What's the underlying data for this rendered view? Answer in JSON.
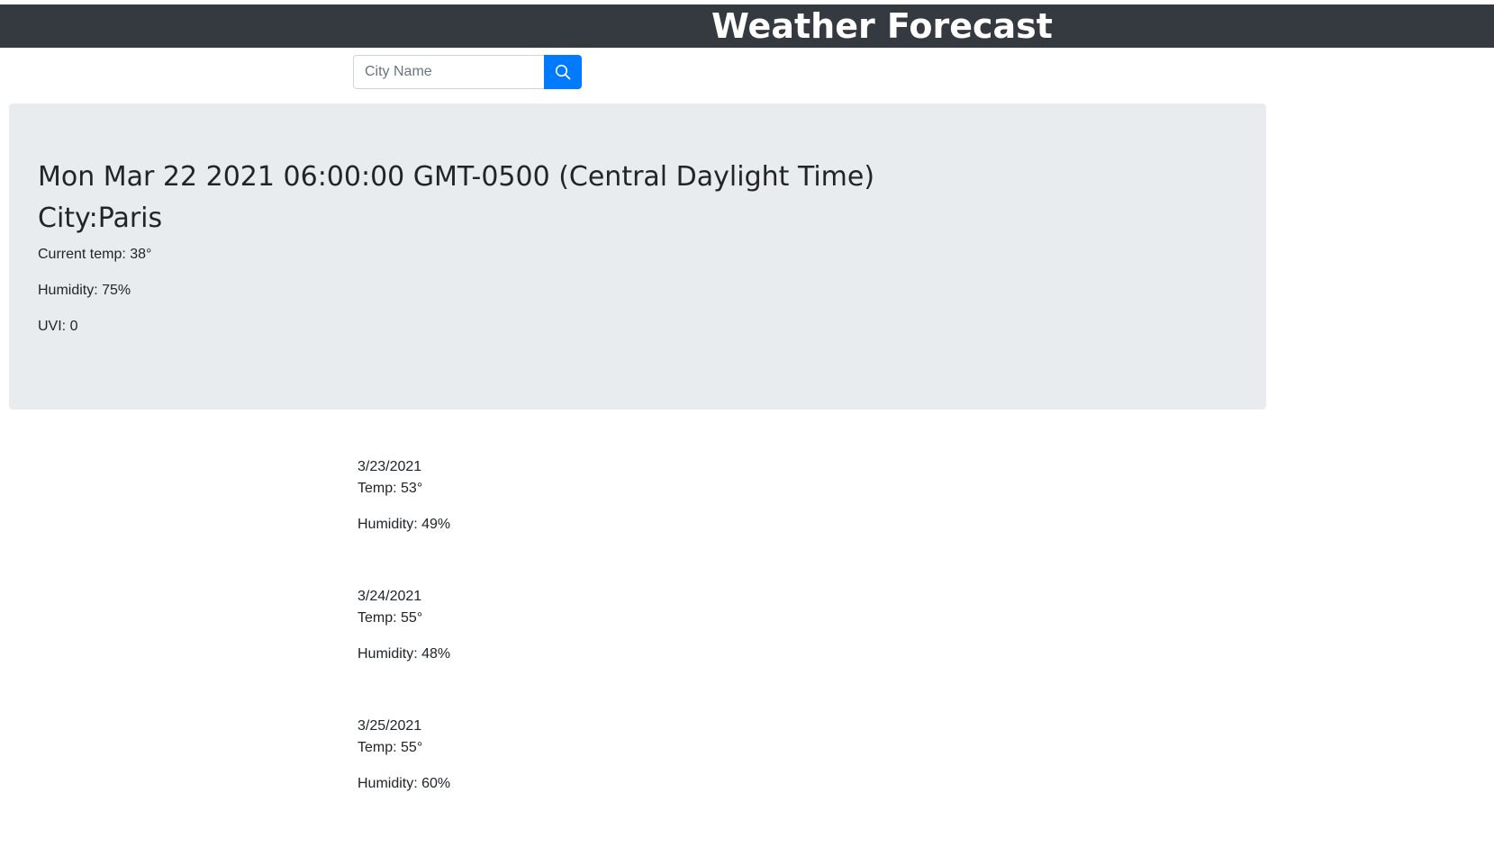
{
  "header": {
    "title": "Weather Forecast"
  },
  "search": {
    "placeholder": "City Name",
    "value": "",
    "button_icon": "search-icon"
  },
  "current": {
    "date": "Mon Mar 22 2021 06:00:00 GMT-0500 (Central Daylight Time)",
    "city": "City:Paris",
    "temp": "Current temp: 38°",
    "humidity": "Humidity: 75%",
    "uvi": "UVI: 0"
  },
  "forecast": [
    {
      "date": "3/23/2021",
      "temp": "Temp: 53°",
      "humidity": "Humidity: 49%"
    },
    {
      "date": "3/24/2021",
      "temp": "Temp: 55°",
      "humidity": "Humidity: 48%"
    },
    {
      "date": "3/25/2021",
      "temp": "Temp: 55°",
      "humidity": "Humidity: 60%"
    }
  ],
  "colors": {
    "header_bg": "#343a40",
    "accent": "#007bff",
    "panel_bg": "#e9ecef"
  }
}
